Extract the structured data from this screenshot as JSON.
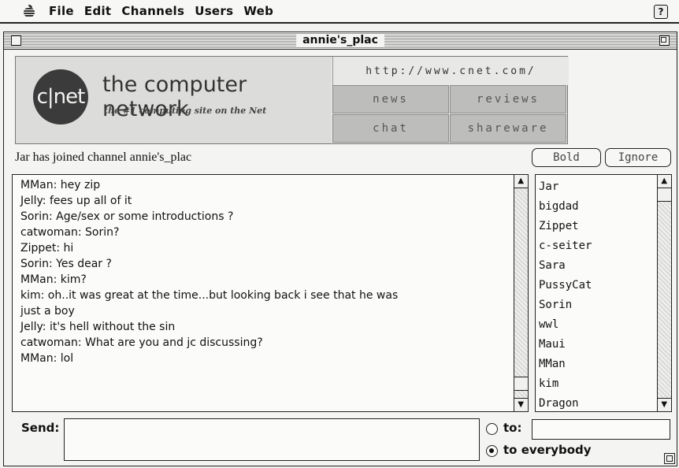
{
  "menubar": {
    "items": [
      "File",
      "Edit",
      "Channels",
      "Users",
      "Web"
    ],
    "help_label": "?"
  },
  "window": {
    "title": "annie's_plac"
  },
  "banner": {
    "logo_text": "c|net",
    "brand_name": "the computer network",
    "tagline": "the #1 computing site on the Net",
    "url": "http://www.cnet.com/",
    "nav": [
      "news",
      "reviews",
      "chat",
      "shareware"
    ]
  },
  "status": {
    "message": "Jar has joined channel annie's_plac"
  },
  "buttons": {
    "bold": "Bold",
    "ignore": "Ignore"
  },
  "chat": {
    "lines": [
      "MMan: hey zip",
      "Jelly: fees up  all of it",
      "Sorin: Age/sex or some introductions ?",
      "catwoman: Sorin?",
      "Zippet: hi",
      "Sorin: Yes dear ?",
      "MMan: kim?",
      "kim: oh..it was great at the time...but looking back i see that he was",
      "just a boy",
      "Jelly: it's hell without the sin",
      "catwoman: What are you and jc discussing?",
      "MMan: lol"
    ]
  },
  "users": [
    "Jar",
    "bigdad",
    "Zippet",
    "c-seiter",
    "Sara",
    "PussyCat",
    "Sorin",
    "wwl",
    "Maui",
    "MMan",
    "kim",
    "Dragon"
  ],
  "send": {
    "label": "Send:",
    "value": "",
    "to_label": "to:",
    "to_value": "",
    "everybody_label": "to everybody",
    "selected": "everybody"
  }
}
